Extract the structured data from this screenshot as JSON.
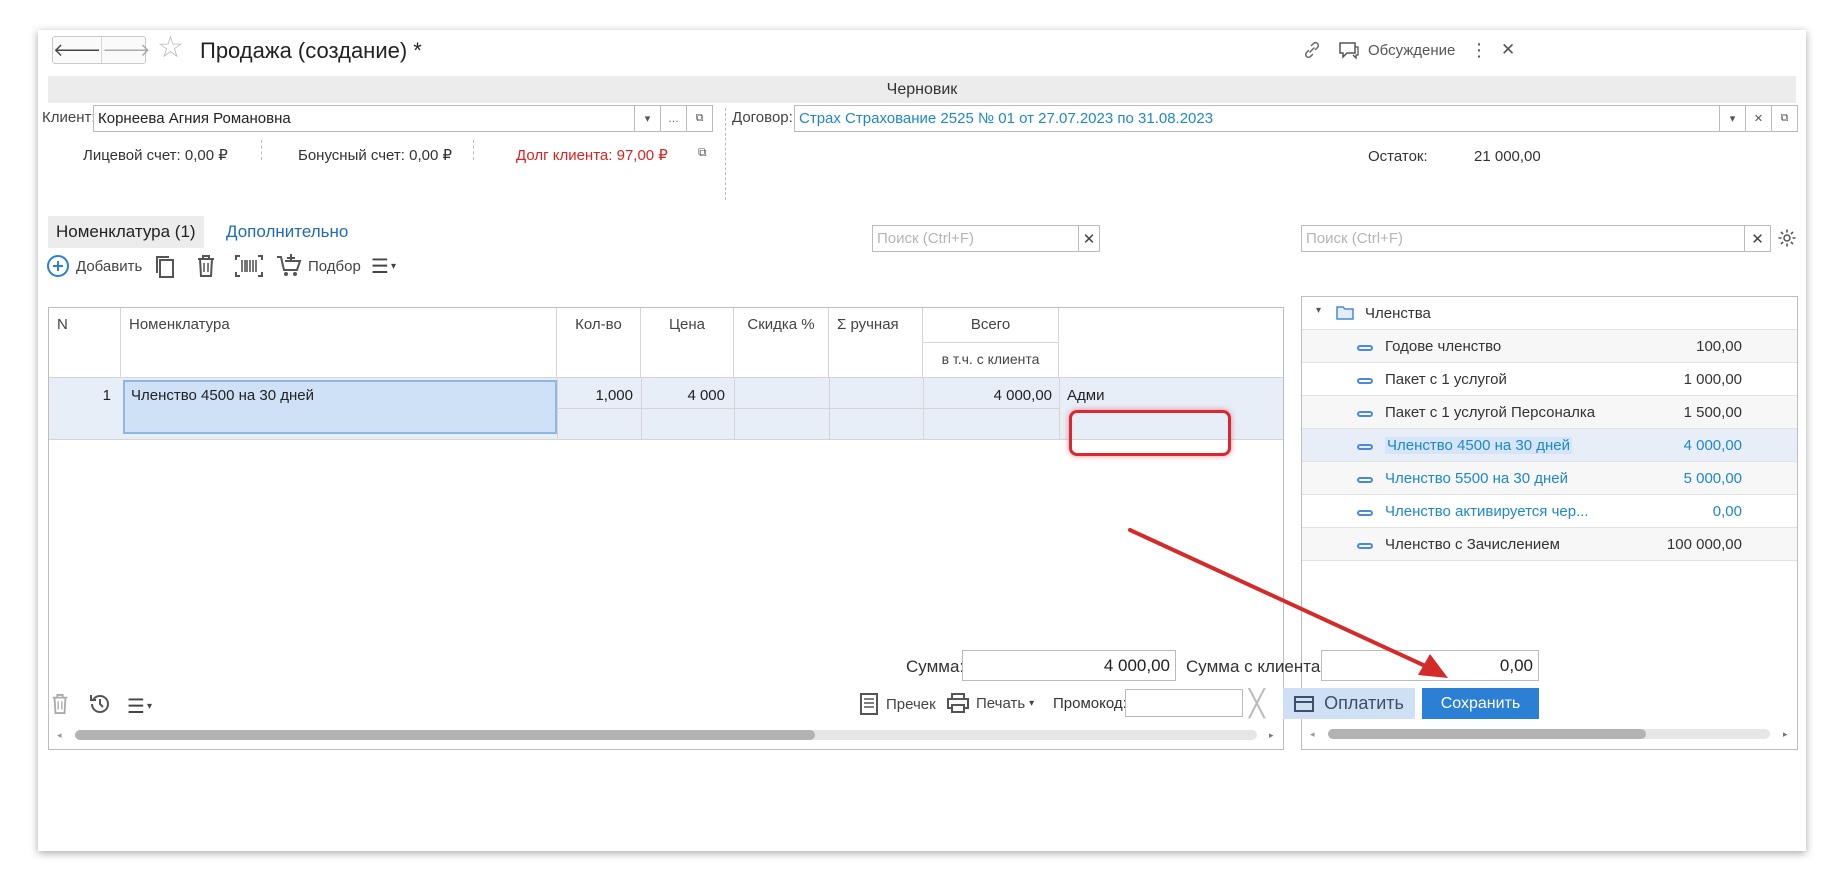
{
  "window": {
    "title": "Продажа (создание) *",
    "discussion_label": "Обсуждение",
    "status_banner": "Черновик"
  },
  "client": {
    "label": "Клиент:",
    "value": "Корнеева Агния Романовна",
    "personal_account": "Лицевой счет: 0,00 ₽",
    "bonus_account": "Бонусный счет: 0,00 ₽",
    "debt": "Долг клиента: 97,00 ₽"
  },
  "contract": {
    "label": "Договор:",
    "value": "Страх Страхование 2525  № 01 от 27.07.2023 по 31.08.2023",
    "remainder_label": "Остаток:",
    "remainder_value": "21 000,00"
  },
  "tabs": [
    {
      "label": "Номенклатура (1)",
      "active": true
    },
    {
      "label": "Дополнительно",
      "active": false
    }
  ],
  "toolbar": {
    "add_label": "Добавить",
    "pick_label": "Подбор",
    "search_placeholder": "Поиск (Ctrl+F)"
  },
  "table": {
    "columns": {
      "n": "N",
      "item": "Номенклатура",
      "qty": "Кол-во",
      "price": "Цена",
      "discount": "Скидка %",
      "manual": "Σ ручная",
      "total": "Всего",
      "total_sub": "в т.ч. с клиента"
    },
    "rows": [
      {
        "n": "1",
        "item": "Членство 4500 на 30 дней",
        "qty": "1,000",
        "price": "4 000",
        "discount": "",
        "manual": "",
        "total": "4 000,00",
        "extra": "Адми"
      }
    ]
  },
  "tree": {
    "search_placeholder": "Поиск (Ctrl+F)",
    "folder": "Членства",
    "items": [
      {
        "name": "Годове членство",
        "price": "100,00",
        "style": "normal"
      },
      {
        "name": "Пакет с 1 услугой",
        "price": "1 000,00",
        "style": "normal"
      },
      {
        "name": "Пакет с 1 услугой Персоналка",
        "price": "1 500,00",
        "style": "normal"
      },
      {
        "name": "Членство 4500 на 30 дней",
        "price": "4 000,00",
        "style": "selected"
      },
      {
        "name": "Членство 5500 на 30 дней",
        "price": "5 000,00",
        "style": "link"
      },
      {
        "name": "Членство активируется чер...",
        "price": "0,00",
        "style": "link"
      },
      {
        "name": "Членство с Зачислением",
        "price": "100 000,00",
        "style": "normal"
      }
    ]
  },
  "totals": {
    "sum_label": "Сумма:",
    "sum_value": "4 000,00",
    "client_sum_label": "Сумма с клиента:",
    "client_sum_value": "0,00"
  },
  "bottom_bar": {
    "receipt_label": "Пречек",
    "print_label": "Печать",
    "promo_label": "Промокод:",
    "promo_value": "",
    "pay_label": "Оплатить",
    "save_label": "Сохранить"
  },
  "colors": {
    "accent": "#2b7fd4",
    "link": "#1e88c8",
    "debt": "#e02020",
    "highlight_frame": "#d9282f",
    "arrow": "#d42a2a"
  }
}
